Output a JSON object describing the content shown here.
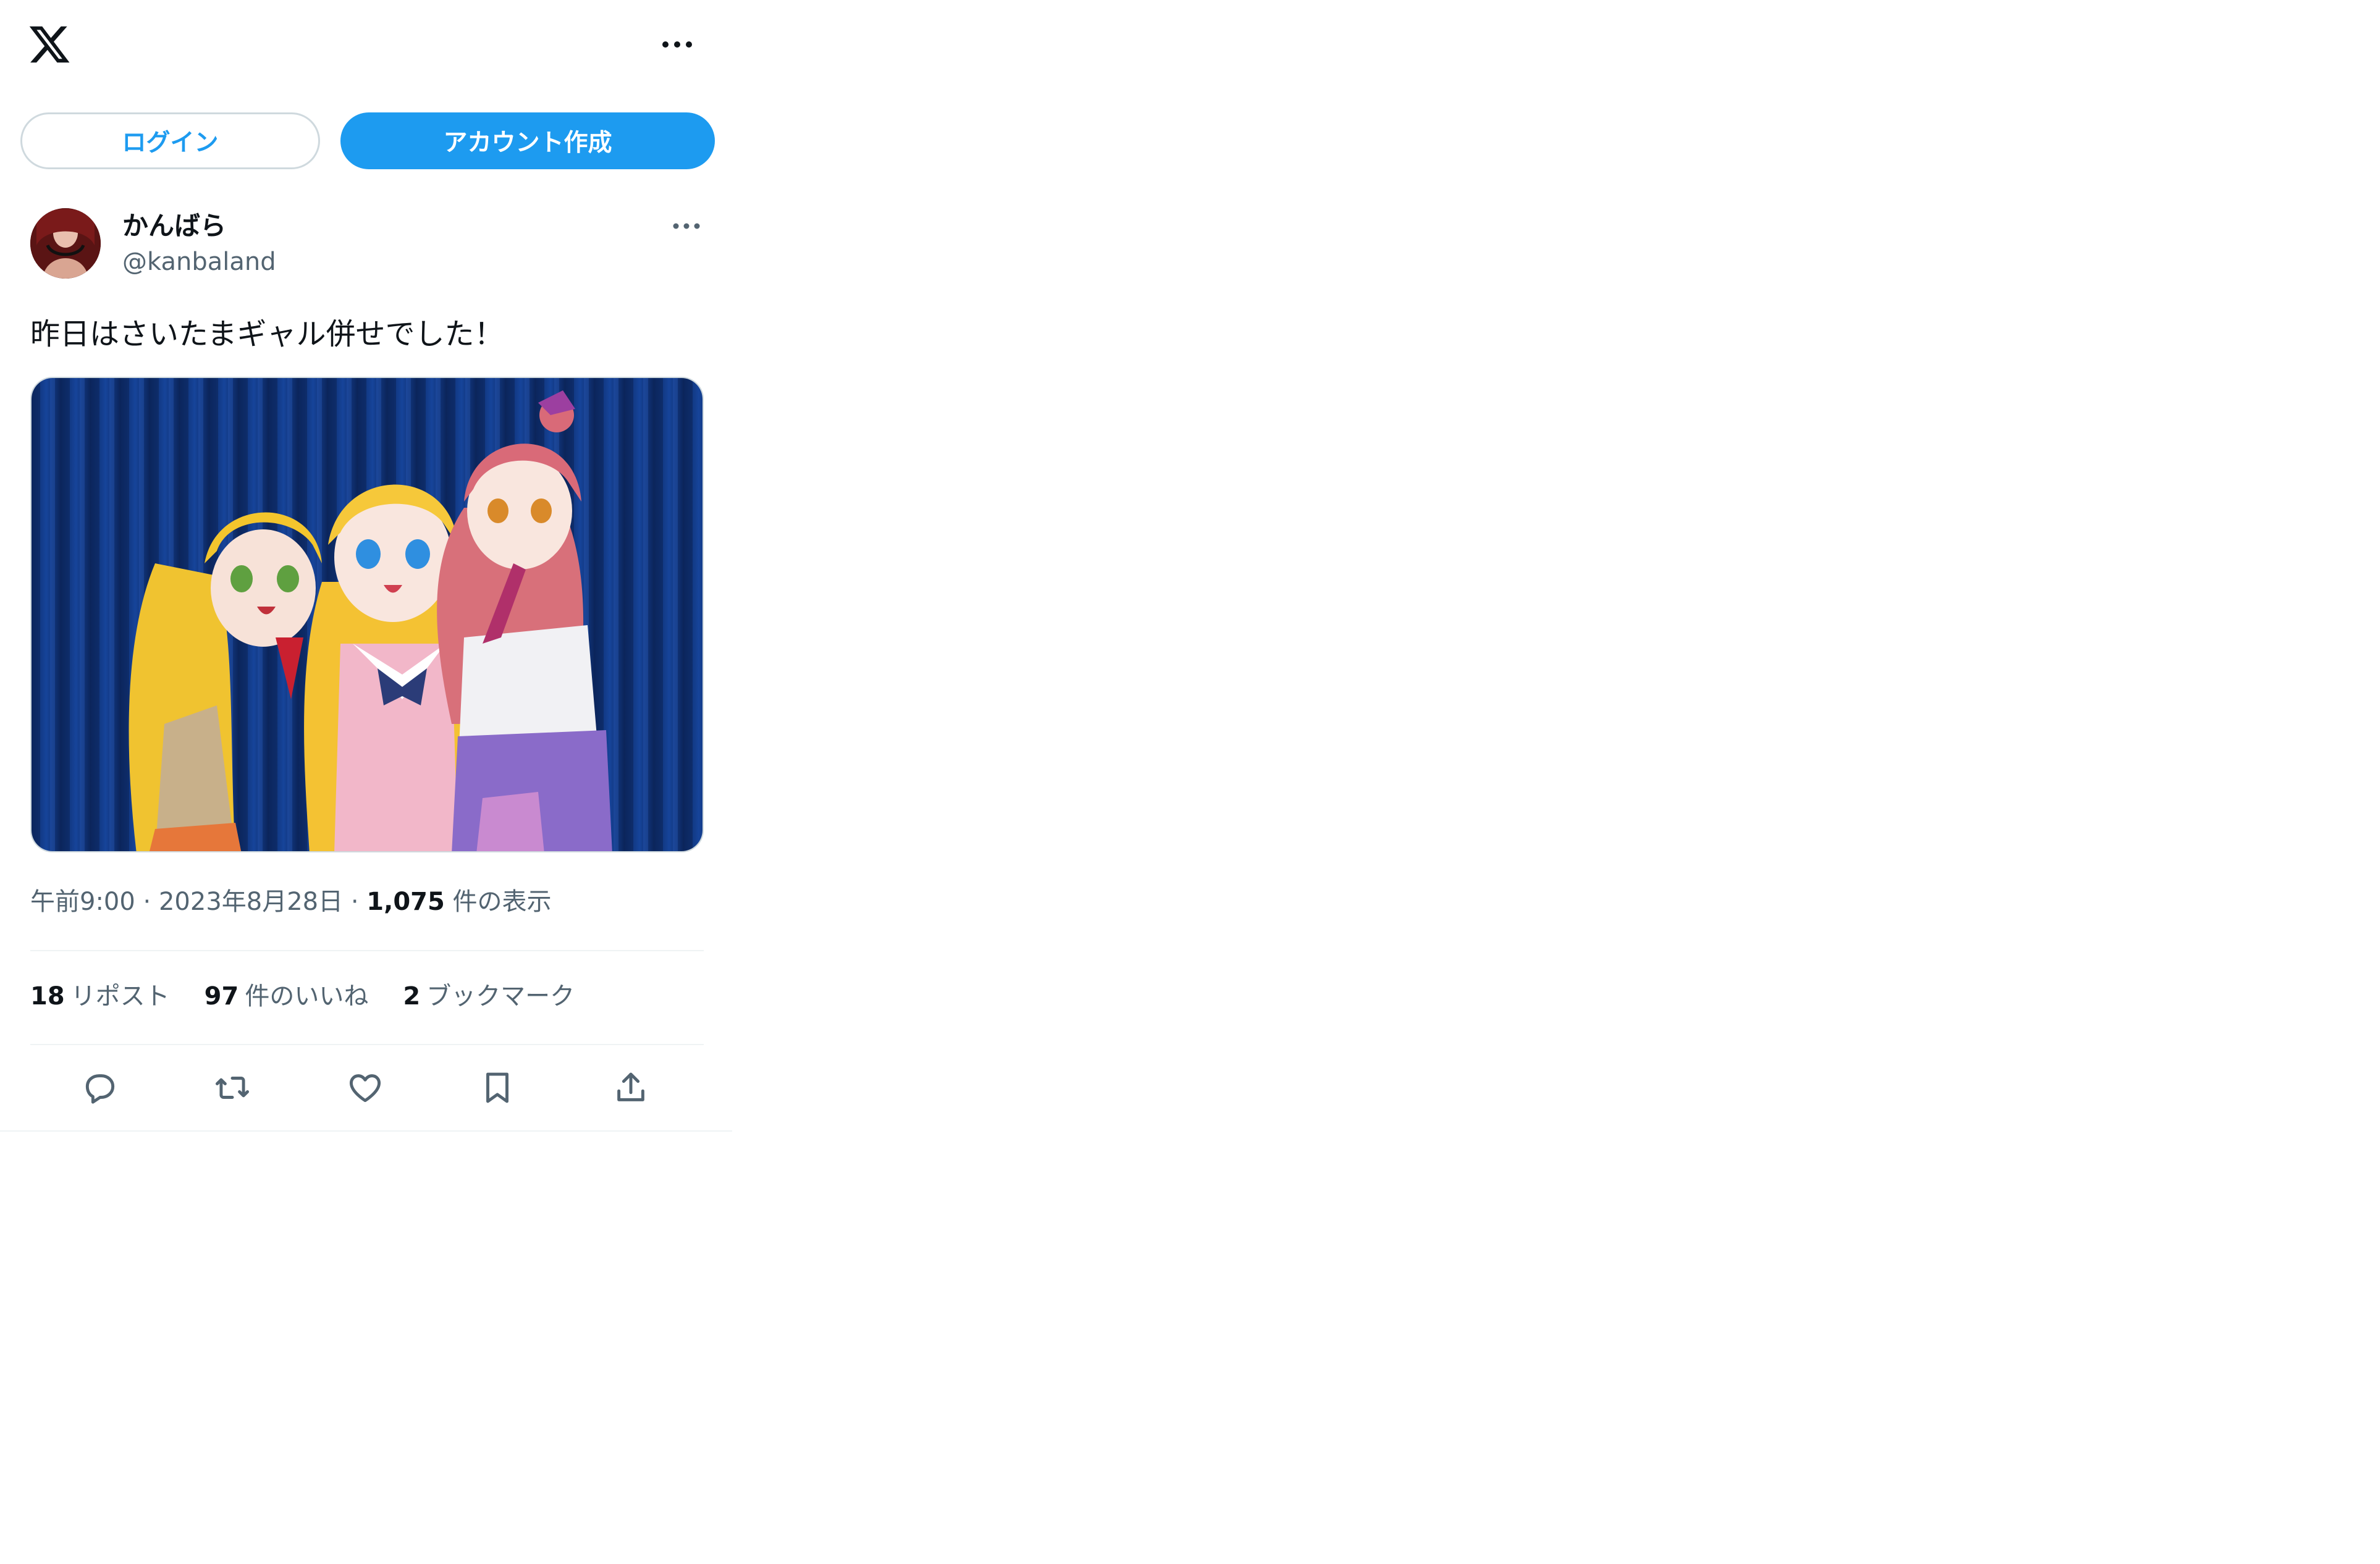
{
  "header": {
    "logo_icon": "x-logo-icon",
    "more_icon": "more-horizontal-icon"
  },
  "auth": {
    "login_label": "ログイン",
    "signup_label": "アカウント作成"
  },
  "post": {
    "author": {
      "display_name": "かんばら",
      "handle": "@kanbaland",
      "avatar_icon": "avatar-image"
    },
    "text": "昨日はさいたまギャル併せでした！",
    "media_description": "photo",
    "meta": {
      "time": "午前9:00",
      "date": "2023年8月28日",
      "views_count": "1,075",
      "views_label": "件の表示",
      "separator": "·"
    },
    "stats": [
      {
        "count": "18",
        "label": "リポスト"
      },
      {
        "count": "97",
        "label": "件のいいね"
      },
      {
        "count": "2",
        "label": "ブックマーク"
      }
    ],
    "actions": [
      "reply-icon",
      "repost-icon",
      "like-icon",
      "bookmark-icon",
      "share-icon"
    ]
  },
  "colors": {
    "accent": "#1d9bf0",
    "text_primary": "#0f1419",
    "text_secondary": "#536471",
    "border": "#cfd9de",
    "divider": "#eff3f4"
  }
}
